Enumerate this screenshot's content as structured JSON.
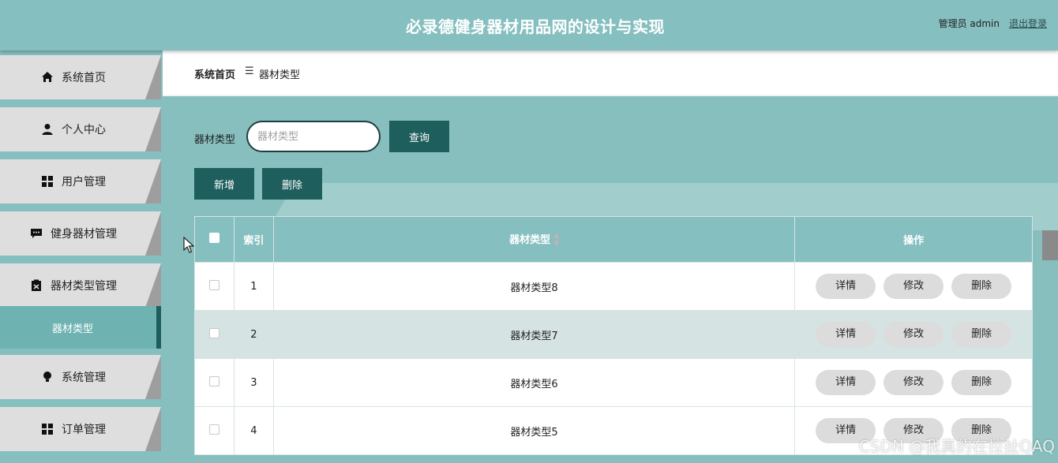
{
  "header": {
    "title": "必录德健身器材用品网的设计与实现",
    "user": "管理员 admin",
    "logout": "退出登录"
  },
  "sidebar": {
    "items": [
      {
        "label": "系统首页",
        "icon": "home-icon"
      },
      {
        "label": "个人中心",
        "icon": "person-icon"
      },
      {
        "label": "用户管理",
        "icon": "grid-icon"
      },
      {
        "label": "健身器材管理",
        "icon": "chat-icon"
      },
      {
        "label": "器材类型管理",
        "icon": "clipboard-icon"
      },
      {
        "label": "系统管理",
        "icon": "bulb-icon"
      },
      {
        "label": "订单管理",
        "icon": "grid-icon"
      }
    ],
    "active_sub": "器材类型"
  },
  "breadcrumb": {
    "home": "系统首页",
    "sep": "☰",
    "current": "器材类型"
  },
  "search": {
    "label": "器材类型",
    "placeholder": "器材类型",
    "button": "查询"
  },
  "actions": {
    "add": "新增",
    "delete": "删除"
  },
  "table": {
    "headers": [
      "索引",
      "器材类型",
      "操作"
    ],
    "rows": [
      {
        "index": "1",
        "type": "器材类型8"
      },
      {
        "index": "2",
        "type": "器材类型7"
      },
      {
        "index": "3",
        "type": "器材类型6"
      },
      {
        "index": "4",
        "type": "器材类型5"
      }
    ],
    "row_actions": [
      "详情",
      "修改",
      "删除"
    ]
  },
  "watermark": "CSDN @我真的在拉扯QAQ",
  "colors": {
    "header_bg": "#86bfc0",
    "accent_dark": "#1e5e5c",
    "row_alt": "#d5e3e2"
  }
}
